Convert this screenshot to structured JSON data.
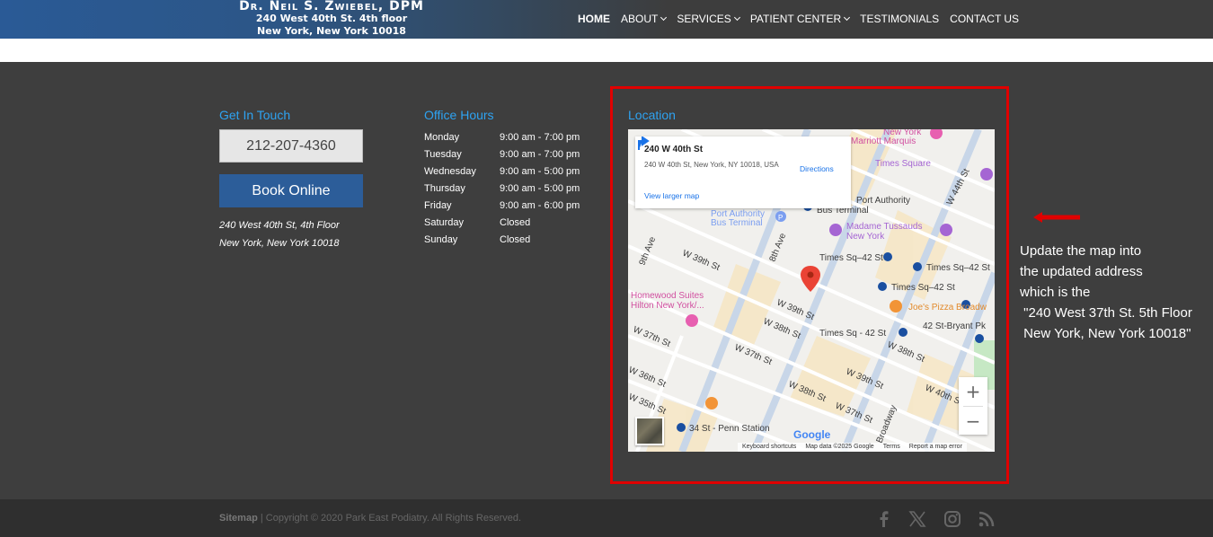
{
  "header": {
    "logo_name": "Dr. Neil S. Zwiebel, DPM",
    "logo_line1": "240 West 40th St. 4th floor",
    "logo_line2": "New York, New York 10018",
    "nav": [
      {
        "label": "HOME",
        "active": true,
        "dropdown": false
      },
      {
        "label": "ABOUT",
        "active": false,
        "dropdown": true
      },
      {
        "label": "SERVICES",
        "active": false,
        "dropdown": true
      },
      {
        "label": "PATIENT CENTER",
        "active": false,
        "dropdown": true
      },
      {
        "label": "TESTIMONIALS",
        "active": false,
        "dropdown": false
      },
      {
        "label": "CONTACT US",
        "active": false,
        "dropdown": false
      }
    ]
  },
  "footer": {
    "get_in_touch": {
      "title": "Get In Touch",
      "phone": "212-207-4360",
      "book_label": "Book Online",
      "address_line1": "240 West 40th St, 4th Floor",
      "address_line2": "New York, New York 10018"
    },
    "office_hours": {
      "title": "Office Hours",
      "rows": [
        {
          "day": "Monday",
          "time": "9:00 am - 7:00 pm"
        },
        {
          "day": "Tuesday",
          "time": "9:00 am - 7:00 pm"
        },
        {
          "day": "Wednesday",
          "time": "9:00 am - 5:00 pm"
        },
        {
          "day": "Thursday",
          "time": "9:00 am - 5:00 pm"
        },
        {
          "day": "Friday",
          "time": "9:00 am - 6:00 pm"
        },
        {
          "day": "Saturday",
          "time": "Closed"
        },
        {
          "day": "Sunday",
          "time": "Closed"
        }
      ]
    },
    "location": {
      "title": "Location",
      "card_title": "240 W 40th St",
      "card_address": "240 W 40th St, New York, NY 10018, USA",
      "directions_label": "Directions",
      "larger_map_label": "View larger map",
      "zoom_in": "+",
      "zoom_out": "−",
      "google": "Google",
      "attribution": [
        "Keyboard shortcuts",
        "Map data ©2025 Google",
        "Terms",
        "Report a map error"
      ],
      "labels": [
        "New York",
        "Marriott Marquis",
        "Times Square",
        "Port Authority",
        "Port Authority",
        "Bus Terminal",
        "Bus Terminal",
        "W 44th St",
        "Madame Tussauds",
        "New York",
        "9th Ave",
        "W 39th St",
        "8th Ave",
        "Times Sq–42 St",
        "Times Sq–42 St",
        "Times Sq–42 St",
        "W 39th St",
        "Homewood Suites",
        "Hilton New York/...",
        "Joe's Pizza Broadw",
        "W 38th St",
        "42 St-Bryant Pk",
        "Times Sq - 42 St",
        "W 37th St",
        "W 38th St",
        "W 36th St",
        "W 37th St",
        "W 40th St",
        "W 39th St",
        "W 38th St",
        "W 37th St",
        "W 35th St",
        "34 St - Penn Station",
        "Broadway",
        "P"
      ]
    }
  },
  "annotation": {
    "note": "Update the map into\nthe updated address\nwhich is the\n \"240 West 37th St. 5th Floor\n New York, New York 10018\""
  },
  "bottom": {
    "sitemap": "Sitemap",
    "copyright": " | Copyright © 2020 Park East Podiatry. All Rights Reserved."
  },
  "colors": {
    "accent": "#2ea3f2",
    "book_button": "#2c5d99",
    "footer_bg": "#3e3e3e",
    "bottom_bg": "#2f2f2f",
    "highlight": "#e00000"
  },
  "icons": [
    "chevron-down-icon",
    "directions-icon",
    "map-pin-icon",
    "satellite-icon",
    "arrow-left-icon",
    "facebook-icon",
    "x-icon",
    "instagram-icon",
    "rss-icon"
  ]
}
